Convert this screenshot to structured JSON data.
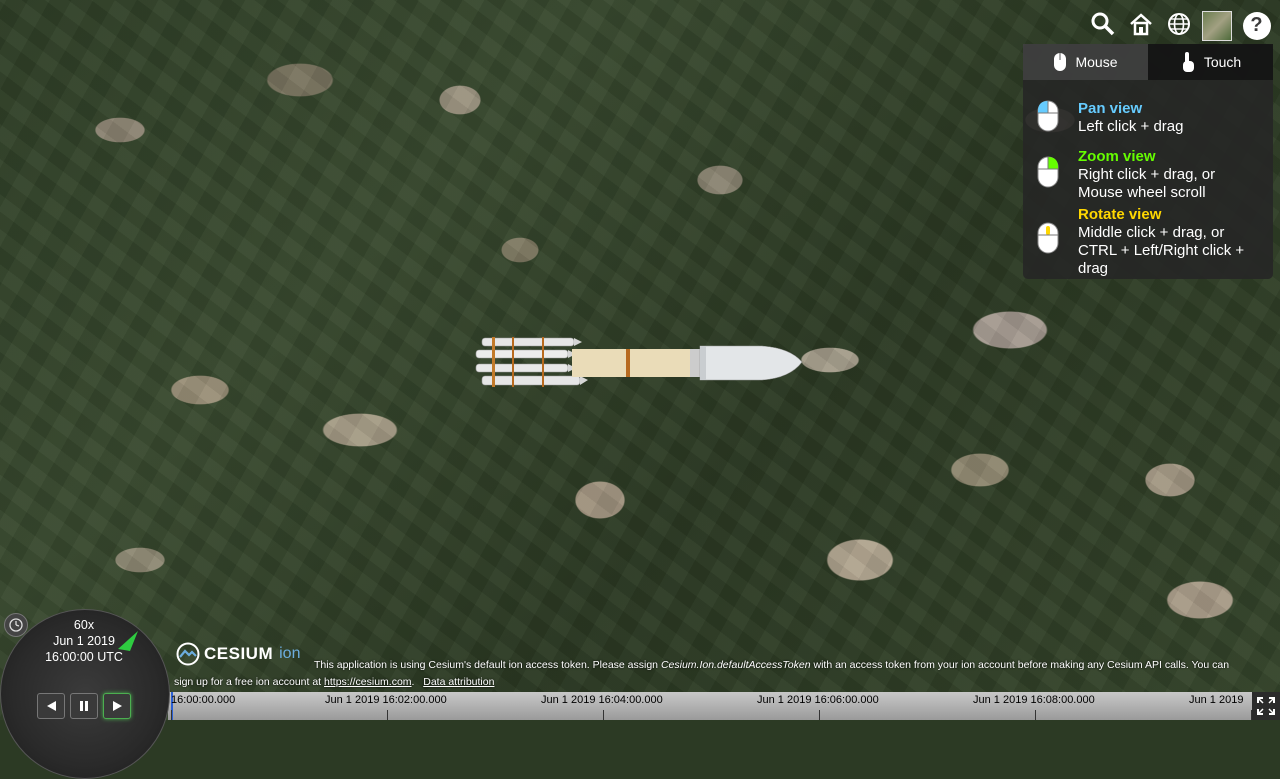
{
  "toolbar": {
    "buttons": [
      {
        "name": "search-icon"
      },
      {
        "name": "home-icon"
      },
      {
        "name": "globe-icon"
      },
      {
        "name": "base-layer-picker"
      }
    ],
    "help": "?"
  },
  "navigation_help": {
    "tabs": [
      {
        "label": "Mouse",
        "active": true
      },
      {
        "label": "Touch",
        "active": false
      }
    ],
    "items": [
      {
        "title": "Pan view",
        "desc": [
          "Left click + drag"
        ]
      },
      {
        "title": "Zoom view",
        "desc": [
          "Right click + drag, or",
          "Mouse wheel scroll"
        ]
      },
      {
        "title": "Rotate view",
        "desc": [
          "Middle click + drag, or",
          "CTRL + Left/Right click +",
          "drag"
        ]
      }
    ],
    "colors": {
      "pan": "#66ccff",
      "zoom": "#65fd00",
      "rotate": "#ffd700"
    }
  },
  "credits": {
    "logo_word": "CESIUM",
    "logo_ion": "ion",
    "notice_part1": "This application is using Cesium's default ion access token. Please assign ",
    "notice_token": "Cesium.Ion.defaultAccessToken",
    "notice_part2": " with an access token from your ion account before making any Cesium API calls. You can",
    "notice_line2": "sign up for a free ion account at ",
    "notice_link": "https://cesium.com",
    "notice_end": ".",
    "data_attribution": "Data attribution"
  },
  "animation": {
    "speed": "60x",
    "date": "Jun 1 2019",
    "time": "16:00:00 UTC"
  },
  "timeline": {
    "labels": [
      "16:00:00.000",
      "Jun 1 2019 16:02:00.000",
      "Jun 1 2019 16:04:00.000",
      "Jun 1 2019 16:06:00.000",
      "Jun 1 2019 16:08:00.000",
      "Jun 1 2019"
    ]
  }
}
